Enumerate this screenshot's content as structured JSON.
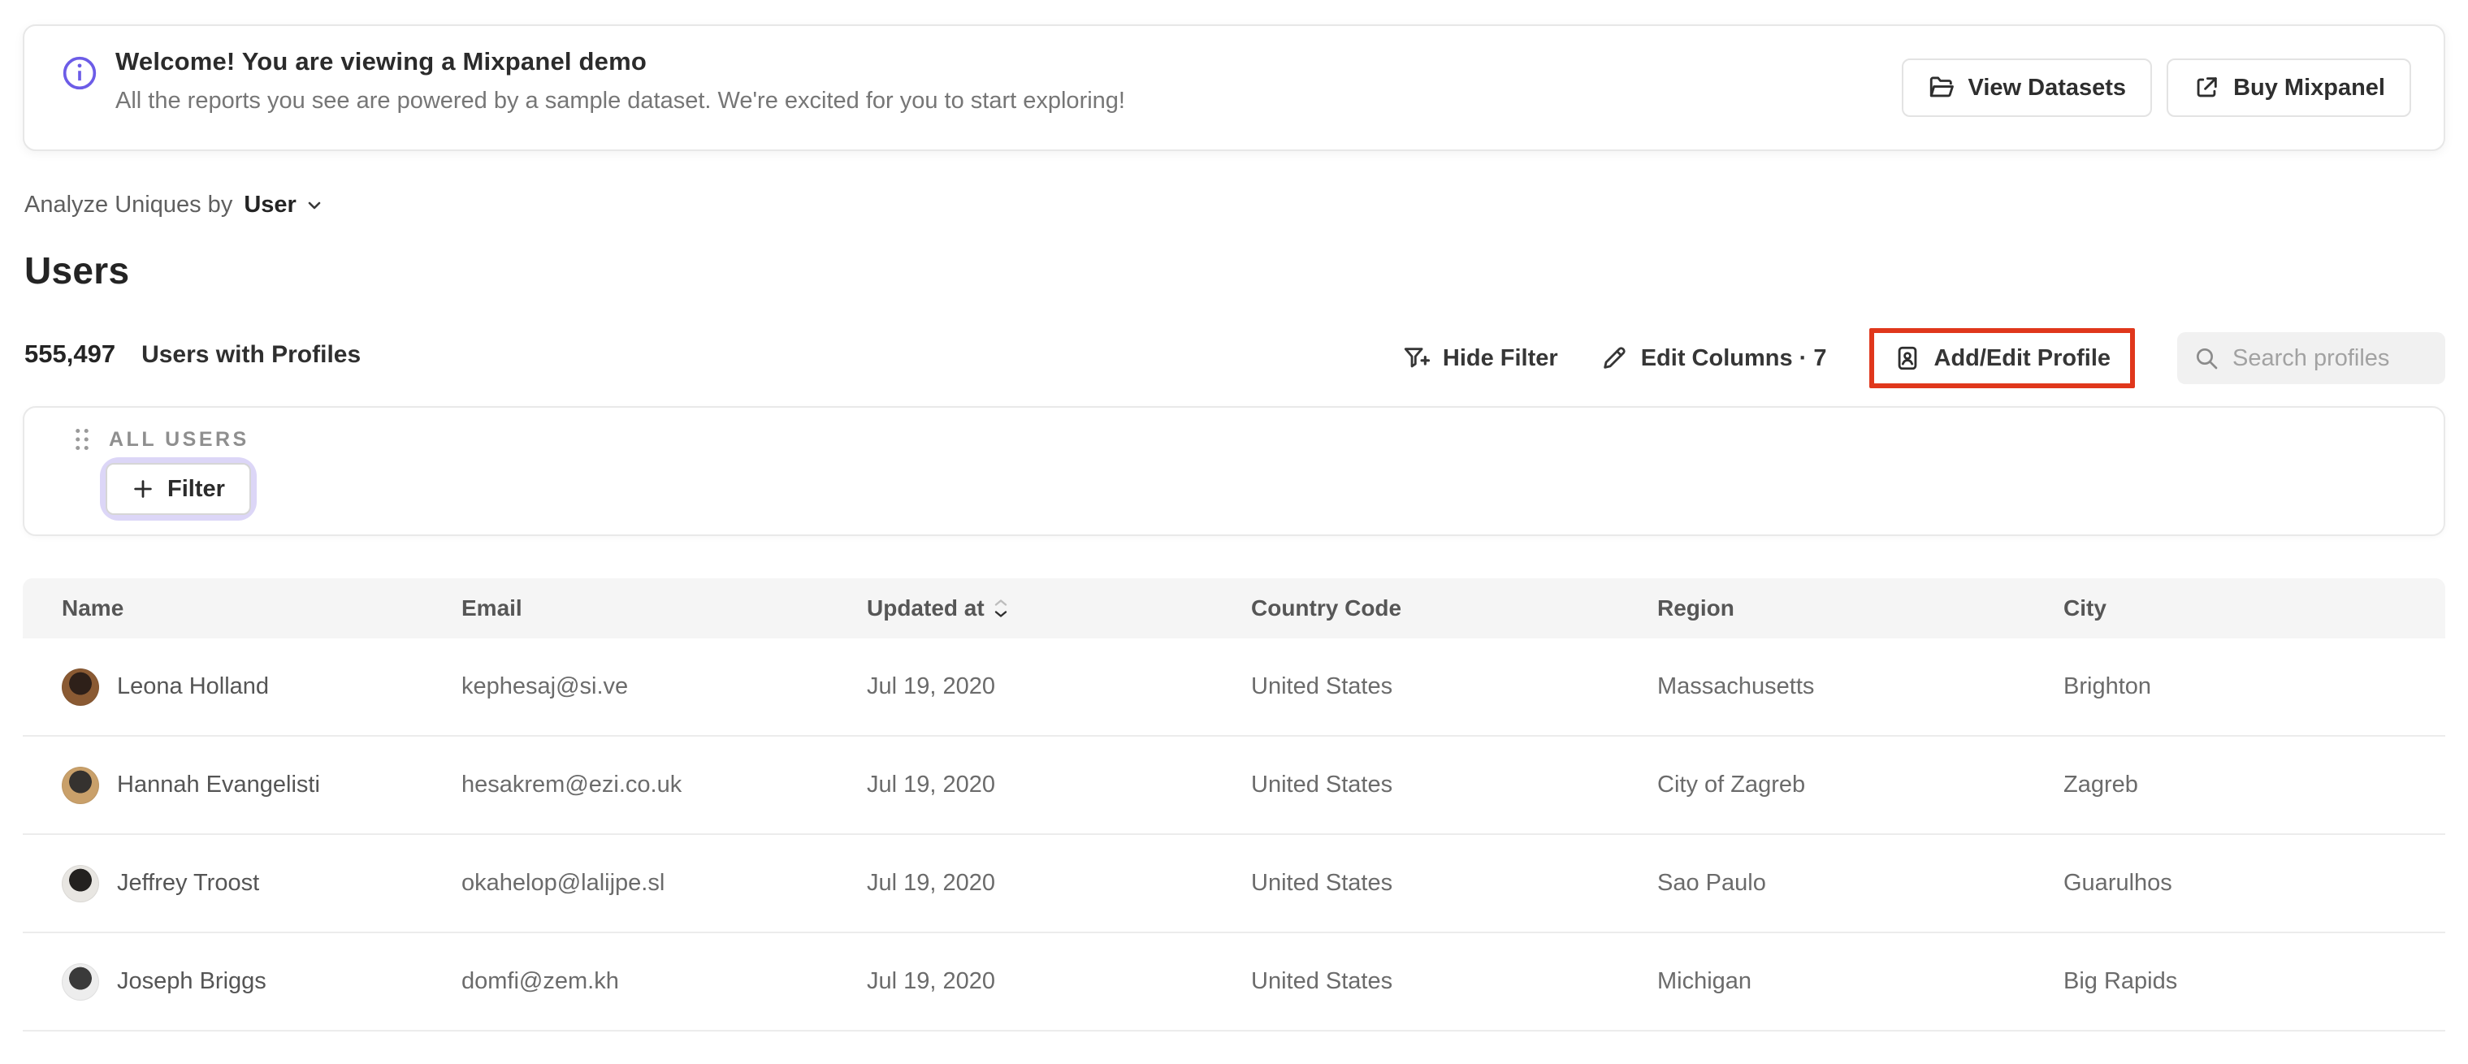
{
  "banner": {
    "title": "Welcome! You are viewing a Mixpanel demo",
    "subtitle": "All the reports you see are powered by a sample dataset. We're excited for you to start exploring!",
    "view_datasets_label": "View Datasets",
    "buy_mixpanel_label": "Buy Mixpanel"
  },
  "analyze_bar": {
    "prefix": "Analyze Uniques by",
    "selected": "User"
  },
  "page_title": "Users",
  "stats": {
    "count": "555,497",
    "label": "Users with Profiles"
  },
  "toolbar": {
    "hide_filter_label": "Hide Filter",
    "edit_columns_label": "Edit Columns · 7",
    "add_edit_profile_label": "Add/Edit Profile",
    "search_placeholder": "Search profiles"
  },
  "filter_panel": {
    "group_label": "ALL USERS",
    "add_filter_label": "Filter"
  },
  "table": {
    "columns": [
      "Name",
      "Email",
      "Updated at",
      "Country Code",
      "Region",
      "City"
    ],
    "sorted_column": "Updated at",
    "rows": [
      {
        "name": "Leona Holland",
        "email": "kephesaj@si.ve",
        "updated_at": "Jul 19, 2020",
        "country_code": "United States",
        "region": "Massachusetts",
        "city": "Brighton",
        "avatar_colors": [
          "#8a5a33",
          "#2e2019"
        ]
      },
      {
        "name": "Hannah Evangelisti",
        "email": "hesakrem@ezi.co.uk",
        "updated_at": "Jul 19, 2020",
        "country_code": "United States",
        "region": "City of Zagreb",
        "city": "Zagreb",
        "avatar_colors": [
          "#c9a06a",
          "#35322f"
        ]
      },
      {
        "name": "Jeffrey Troost",
        "email": "okahelop@lalijpe.sl",
        "updated_at": "Jul 19, 2020",
        "country_code": "United States",
        "region": "Sao Paulo",
        "city": "Guarulhos",
        "avatar_colors": [
          "#e8e6e2",
          "#23211f"
        ]
      },
      {
        "name": "Joseph Briggs",
        "email": "domfi@zem.kh",
        "updated_at": "Jul 19, 2020",
        "country_code": "United States",
        "region": "Michigan",
        "city": "Big Rapids",
        "avatar_colors": [
          "#ededed",
          "#3a3a3a"
        ]
      }
    ]
  },
  "colors": {
    "accent_purple": "#6c5ce7",
    "highlight_red": "#e0371c",
    "focus_ring": "#dcd6f7"
  }
}
